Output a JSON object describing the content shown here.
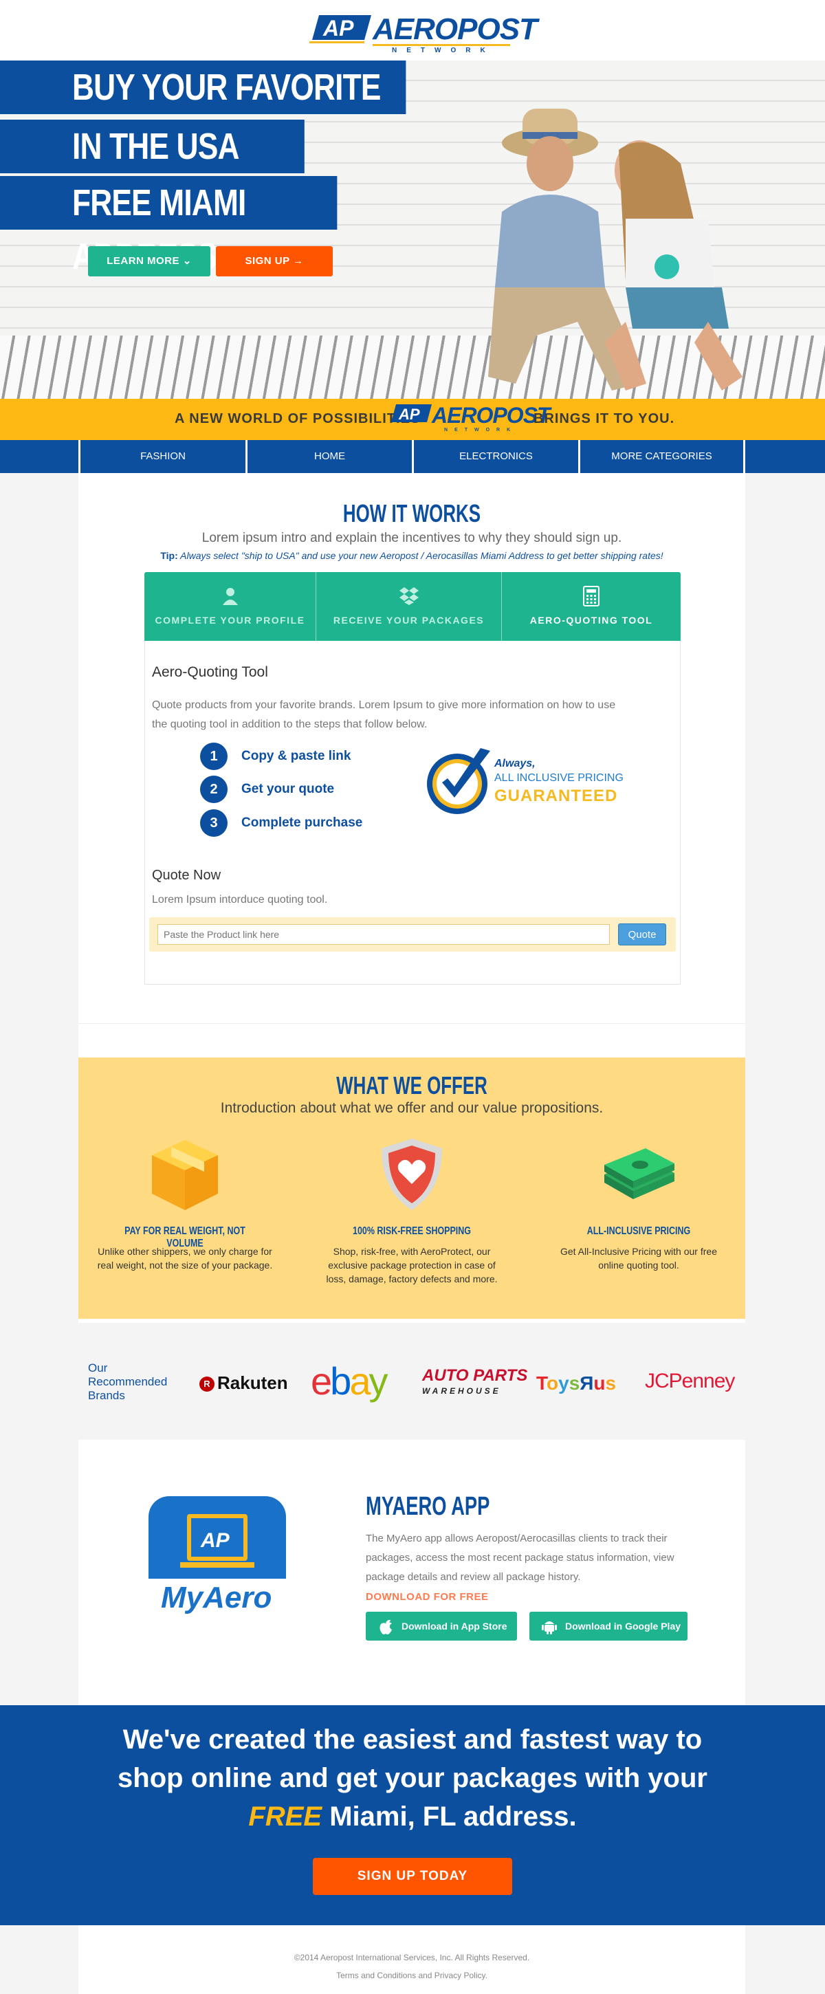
{
  "header": {
    "logo_text": "AEROPOST",
    "logo_sub": "NETWORK",
    "logo_mark": "AP"
  },
  "hero": {
    "headline_1": "BUY YOUR FAVORITE BRANDS",
    "headline_2": "IN THE USA WITH A",
    "headline_3": "FREE MIAMI ADDRESS.",
    "learn_more": "LEARN MORE",
    "sign_up": "SIGN UP"
  },
  "strip": {
    "left": "A NEW WORLD OF POSSIBILITIES",
    "right": "BRINGS IT TO YOU.",
    "logo_text": "AEROPOST",
    "logo_sub": "NETWORK",
    "logo_mark": "AP"
  },
  "nav": [
    "FASHION",
    "HOME",
    "ELECTRONICS",
    "MORE CATEGORIES"
  ],
  "how_it_works": {
    "title": "HOW IT WORKS",
    "intro": "Lorem ipsum intro and explain the incentives to why they should sign up.",
    "tip_label": "Tip:",
    "tip_text": "Always select \"ship to USA\" and use your new Aeropost / Aerocasillas Miami Address to get better shipping rates!",
    "tabs": [
      "COMPLETE YOUR PROFILE",
      "RECEIVE YOUR PACKAGES",
      "AERO-QUOTING TOOL"
    ],
    "panel_title": "Aero-Quoting Tool",
    "panel_desc": "Quote products from your favorite brands. Lorem Ipsum to give more information on how to use the quoting tool in addition to the steps that follow below.",
    "steps": [
      {
        "num": "1",
        "text": "Copy & paste link"
      },
      {
        "num": "2",
        "text": "Get your quote"
      },
      {
        "num": "3",
        "text": "Complete purchase"
      }
    ],
    "guarantee": {
      "always": "Always,",
      "inclusive": "ALL INCLUSIVE PRICING",
      "guaranteed": "GUARANTEED"
    },
    "quote_title": "Quote Now",
    "quote_desc": "Lorem Ipsum intorduce quoting tool.",
    "quote_placeholder": "Paste the Product link here",
    "quote_button": "Quote"
  },
  "offer": {
    "title": "WHAT WE OFFER",
    "intro": "Introduction about what we offer and our value propositions.",
    "items": [
      {
        "heading": "PAY FOR REAL WEIGHT, NOT VOLUME",
        "text": "Unlike other shippers, we only charge for real weight, not the size of your package."
      },
      {
        "heading": "100% RISK-FREE SHOPPING",
        "text": "Shop, risk-free, with AeroProtect, our exclusive package protection in case of loss, damage, factory defects and more."
      },
      {
        "heading": "ALL-INCLUSIVE PRICING",
        "text": "Get All-Inclusive Pricing with our free online quoting tool."
      }
    ]
  },
  "brands": {
    "label": "Our Recommended Brands",
    "rakuten": "Rakuten",
    "rakuten_mark": "R",
    "ebay_e": "e",
    "ebay_b": "b",
    "ebay_a": "a",
    "ebay_y": "y",
    "autoparts": "AUTO PARTS",
    "autoparts_sub": "WAREHOUSE",
    "toys": [
      "T",
      "o",
      "y",
      "s",
      "Я",
      "u",
      "s"
    ],
    "jcpenney": "JCPenney"
  },
  "app": {
    "title": "MYAERO APP",
    "desc": "The MyAero app allows Aeropost/Aerocasillas clients to track their packages, access the most recent package status information, view package details and review all package history.",
    "download": "DOWNLOAD FOR FREE",
    "app_store": "Download in App Store",
    "google_play": "Download in Google Play",
    "icon_text": "MyAero",
    "icon_mark": "AP"
  },
  "cta": {
    "line1": "We've created the easiest and fastest way to",
    "line2": "shop online and get your packages with your",
    "line3_em": "FREE",
    "line3_rest": " Miami, FL address.",
    "button": "SIGN UP TODAY"
  },
  "footer": {
    "copyright": "©2014 Aeropost International Services, Inc. All Rights Reserved.",
    "links": "Terms and Conditions and Privacy Policy."
  },
  "colors": {
    "brand_blue": "#0d4f9f",
    "green": "#1db48f",
    "orange": "#ff5500",
    "yellow": "#fdb813"
  }
}
